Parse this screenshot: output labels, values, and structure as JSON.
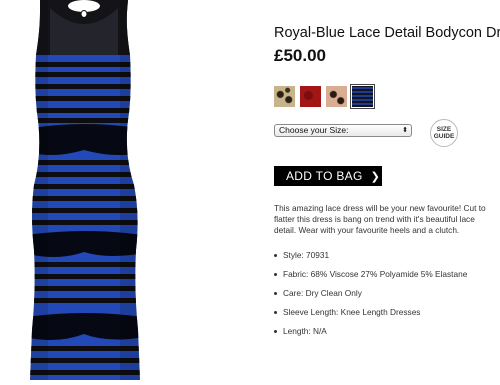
{
  "product": {
    "title": "Royal-Blue Lace Detail Bodycon Dress",
    "price": "£50.00",
    "swatches": [
      {
        "name": "leopard print",
        "color": "#c8b48a"
      },
      {
        "name": "red",
        "color": "#a31616"
      },
      {
        "name": "nude print",
        "color": "#d9ad92"
      },
      {
        "name": "royal blue and black",
        "color": "#213a8a",
        "selected": true
      }
    ],
    "size_select": {
      "value": "Choose your Size:"
    },
    "size_guide": {
      "line1": "SIZE",
      "line2": "GUIDE"
    },
    "add_to_bag_label": "ADD TO BAG",
    "description": "This amazing lace dress will be your new favourite! Cut to flatter this dress is bang on trend with it's beautiful lace detail. Wear with your favourite heels and a clutch.",
    "details": [
      "Style: 70931",
      "Fabric: 68% Viscose 27% Polyamide 5% Elastane",
      "Care: Dry Clean Only",
      "Sleeve Length: Knee Length Dresses",
      "Length: N/A"
    ]
  },
  "colors": {
    "dress_blue": "#2349b8",
    "dress_black": "#0d0d12",
    "button_bg": "#000000"
  }
}
